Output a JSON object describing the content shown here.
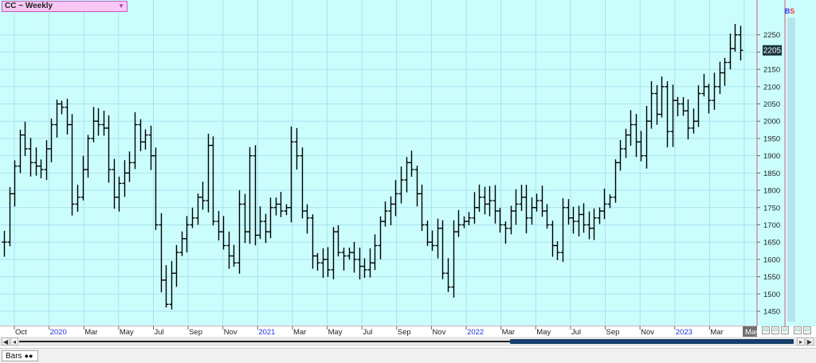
{
  "header": {
    "symbol": "CC ~ Weekly",
    "dropdown_icon": "triangle-down-icon",
    "buy_tag": "B",
    "sell_tag": "S"
  },
  "footer": {
    "tab_label": "Bars",
    "tab_icon": "binoculars-icon"
  },
  "colors": {
    "background": "#ccfdfd",
    "grid": "#a8e2ee",
    "bars": "#000000",
    "axis": "#d06070",
    "last_price_bg": "#16343c",
    "year_label": "#2233dd"
  },
  "chart_data": {
    "type": "ohlc_bar",
    "y_ticks": [
      1450,
      1500,
      1550,
      1600,
      1650,
      1700,
      1750,
      1800,
      1850,
      1900,
      1950,
      2000,
      2050,
      2100,
      2150,
      2200,
      2250
    ],
    "ylim": [
      1420,
      2300
    ],
    "last_price": "2205",
    "x_ticks": [
      {
        "label": "Oct",
        "year": false
      },
      {
        "label": "2020",
        "year": true
      },
      {
        "label": "Mar",
        "year": false
      },
      {
        "label": "May",
        "year": false
      },
      {
        "label": "Jul",
        "year": false
      },
      {
        "label": "Sep",
        "year": false
      },
      {
        "label": "Nov",
        "year": false
      },
      {
        "label": "2021",
        "year": true
      },
      {
        "label": "Mar",
        "year": false
      },
      {
        "label": "May",
        "year": false
      },
      {
        "label": "Jul",
        "year": false
      },
      {
        "label": "Sep",
        "year": false
      },
      {
        "label": "Nov",
        "year": false
      },
      {
        "label": "2022",
        "year": true
      },
      {
        "label": "Mar",
        "year": false
      },
      {
        "label": "May",
        "year": false
      },
      {
        "label": "Jul",
        "year": false
      },
      {
        "label": "Sep",
        "year": false
      },
      {
        "label": "Nov",
        "year": false
      },
      {
        "label": "2023",
        "year": true
      },
      {
        "label": "Mar",
        "year": false
      },
      {
        "label": "May",
        "year": false
      }
    ],
    "closes": [
      1650,
      1790,
      1870,
      1960,
      1920,
      1880,
      1870,
      1860,
      1920,
      1990,
      2050,
      2040,
      1990,
      1760,
      1780,
      1860,
      1950,
      2000,
      1990,
      1980,
      1860,
      1780,
      1820,
      1850,
      1880,
      1990,
      1940,
      1960,
      1900,
      1700,
      1540,
      1470,
      1560,
      1620,
      1660,
      1700,
      1720,
      1780,
      1770,
      1930,
      1710,
      1680,
      1640,
      1610,
      1590,
      1760,
      1680,
      1900,
      1670,
      1710,
      1680,
      1750,
      1760,
      1740,
      1750,
      1940,
      1900,
      1740,
      1720,
      1610,
      1590,
      1600,
      1570,
      1680,
      1620,
      1610,
      1620,
      1600,
      1580,
      1570,
      1590,
      1640,
      1710,
      1740,
      1760,
      1790,
      1830,
      1880,
      1860,
      1790,
      1700,
      1650,
      1640,
      1690,
      1560,
      1520,
      1680,
      1700,
      1710,
      1720,
      1750,
      1780,
      1760,
      1770,
      1740,
      1700,
      1690,
      1740,
      1760,
      1780,
      1720,
      1750,
      1770,
      1740,
      1700,
      1640,
      1620,
      1750,
      1720,
      1710,
      1730,
      1700,
      1690,
      1720,
      1740,
      1760,
      1780,
      1880,
      1920,
      1960,
      1990,
      1940,
      1900,
      2000,
      2080,
      2020,
      2100,
      1970,
      2060,
      2050,
      2030,
      1980,
      2000,
      2080,
      2100,
      2060,
      2100,
      2140,
      2170,
      2210,
      2250,
      2205
    ]
  }
}
